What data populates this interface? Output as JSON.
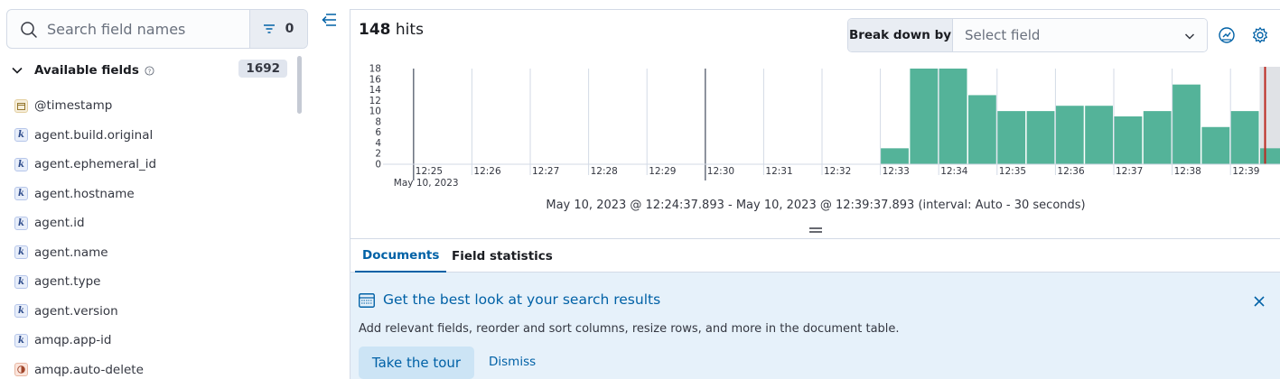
{
  "sidebar": {
    "search_placeholder": "Search field names",
    "filter_count": "0",
    "available_fields_label": "Available fields",
    "available_fields_count": "1692",
    "fields": [
      {
        "name": "@timestamp",
        "type": "date"
      },
      {
        "name": "agent.build.original",
        "type": "keyword"
      },
      {
        "name": "agent.ephemeral_id",
        "type": "keyword"
      },
      {
        "name": "agent.hostname",
        "type": "keyword"
      },
      {
        "name": "agent.id",
        "type": "keyword"
      },
      {
        "name": "agent.name",
        "type": "keyword"
      },
      {
        "name": "agent.type",
        "type": "keyword"
      },
      {
        "name": "agent.version",
        "type": "keyword"
      },
      {
        "name": "amqp.app-id",
        "type": "keyword"
      },
      {
        "name": "amqp.auto-delete",
        "type": "boolean"
      }
    ],
    "keyword_token": "k"
  },
  "header": {
    "hits_count": "148",
    "hits_label": "hits",
    "breakdown_label": "Break down by",
    "breakdown_placeholder": "Select field"
  },
  "chart_data": {
    "type": "bar",
    "x_tick_labels": [
      "12:25",
      "12:26",
      "12:27",
      "12:28",
      "12:29",
      "12:30",
      "12:31",
      "12:32",
      "12:33",
      "12:34",
      "12:35",
      "12:36",
      "12:37",
      "12:38",
      "12:39"
    ],
    "x_date_label": "May 10, 2023",
    "y_ticks": [
      0,
      2,
      4,
      6,
      8,
      10,
      12,
      14,
      16,
      18
    ],
    "ylim": [
      0,
      18
    ],
    "x": [
      "12:24:30",
      "12:25:00",
      "12:25:30",
      "12:26:00",
      "12:26:30",
      "12:27:00",
      "12:27:30",
      "12:28:00",
      "12:28:30",
      "12:29:00",
      "12:29:30",
      "12:30:00",
      "12:30:30",
      "12:31:00",
      "12:31:30",
      "12:32:00",
      "12:32:30",
      "12:33:00",
      "12:33:30",
      "12:34:00",
      "12:34:30",
      "12:35:00",
      "12:35:30",
      "12:36:00",
      "12:36:30",
      "12:37:00",
      "12:37:30",
      "12:38:00",
      "12:38:30",
      "12:39:00",
      "12:39:30"
    ],
    "values": [
      0,
      0,
      0,
      0,
      0,
      0,
      0,
      0,
      0,
      0,
      0,
      0,
      0,
      0,
      0,
      0,
      0,
      3,
      18,
      18,
      13,
      10,
      10,
      11,
      11,
      9,
      10,
      15,
      7,
      10,
      3
    ],
    "bar_color": "#54b399",
    "partial_bucket_color": "#e0e2e6",
    "now_marker_color": "#bd271e",
    "grid": true,
    "range_text": "May 10, 2023 @ 12:24:37.893 - May 10, 2023 @ 12:39:37.893 (interval: Auto - 30 seconds)"
  },
  "tabs": [
    {
      "label": "Documents",
      "active": true
    },
    {
      "label": "Field statistics",
      "active": false
    }
  ],
  "callout": {
    "title": "Get the best look at your search results",
    "text": "Add relevant fields, reorder and sort columns, resize rows, and more in the document table.",
    "tour_button": "Take the tour",
    "dismiss_button": "Dismiss"
  },
  "colors": {
    "accent": "#0061a6",
    "callout_bg": "#e6f1fa",
    "bar": "#54b399"
  }
}
